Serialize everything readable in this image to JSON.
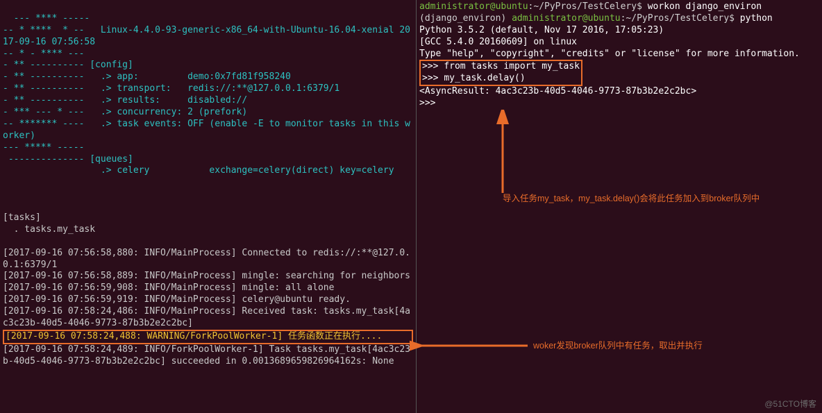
{
  "left": {
    "banner": "--- **** -----\n-- * ****  * --   Linux-4.4.0-93-generic-x86_64-with-Ubuntu-16.04-xenial 2017-09-16 07:56:58\n-- * - **** ---\n- ** ---------- [config]\n- ** ----------   .> app:         demo:0x7fd81f958240\n- ** ----------   .> transport:   redis://:**@127.0.0.1:6379/1\n- ** ----------   .> results:     disabled://\n- *** --- * ---   .> concurrency: 2 (prefork)\n-- ******* ----   .> task events: OFF (enable -E to monitor tasks in this worker)\n--- ***** -----\n -------------- [queues]\n                  .> celery           exchange=celery(direct) key=celery\n",
    "tasks_hdr": "\n\n[tasks]",
    "tasks_list": "  . tasks.my_task\n",
    "log1": "[2017-09-16 07:56:58,880: INFO/MainProcess] Connected to redis://:**@127.0.0.1:6379/1",
    "log2": "[2017-09-16 07:56:58,889: INFO/MainProcess] mingle: searching for neighbors",
    "log3": "[2017-09-16 07:56:59,908: INFO/MainProcess] mingle: all alone",
    "log4": "[2017-09-16 07:56:59,919: INFO/MainProcess] celery@ubuntu ready.",
    "log5": "[2017-09-16 07:58:24,486: INFO/MainProcess] Received task: tasks.my_task[4ac3c23b-40d5-4046-9773-87b3b2e2c2bc]",
    "warn": "[2017-09-16 07:58:24,488: WARNING/ForkPoolWorker-1] 任务函数正在执行....",
    "log6": "[2017-09-16 07:58:24,489: INFO/ForkPoolWorker-1] Task tasks.my_task[4ac3c23b-40d5-4046-9773-87b3b2e2c2bc] succeeded in 0.0013689659826964162s: None"
  },
  "right": {
    "prompt1_user": "administrator@ubuntu",
    "prompt1_path": ":~/PyPros/TestCelery$ ",
    "cmd1": "workon django_environ",
    "venv": "(django_environ) ",
    "prompt2_user": "administrator@ubuntu",
    "prompt2_path": ":~/PyPros/TestCelery$ ",
    "cmd2": "python",
    "pyver": "Python 3.5.2 (default, Nov 17 2016, 17:05:23)\n[GCC 5.4.0 20160609] on linux\nType \"help\", \"copyright\", \"credits\" or \"license\" for more information.",
    "ps1a": ">>> ",
    "line_import": "from tasks import my_task",
    "ps1b": ">>> ",
    "line_delay": "my_task.delay()",
    "result": "<AsyncResult: 4ac3c23b-40d5-4046-9773-87b3b2e2c2bc>",
    "ps1c": ">>>",
    "anno1": "导入任务my_task，my_task.delay()会将此任务加入到broker队列中",
    "anno2": "woker发现broker队列中有任务，取出并执行"
  },
  "watermark": "@51CTO博客"
}
